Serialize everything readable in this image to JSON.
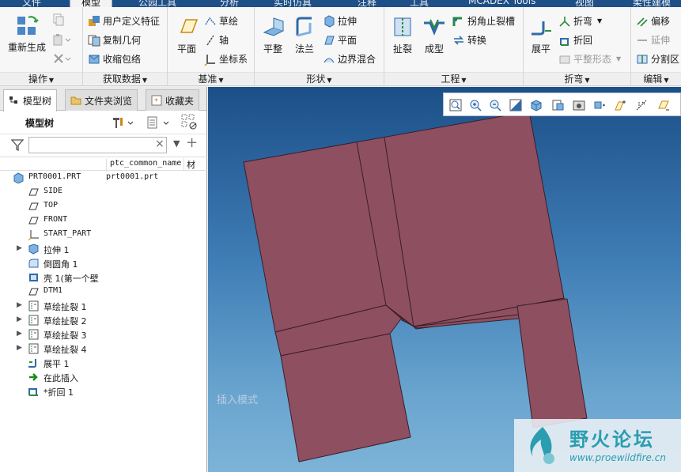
{
  "tabs": [
    "文件",
    "模型",
    "公园工具",
    "分析",
    "实时仿真",
    "注释",
    "工具",
    "MCADEX Tools",
    "视图",
    "柔性建模"
  ],
  "ribbon": {
    "operations": {
      "label": "操作",
      "regenerate": "重新生成"
    },
    "get_data": {
      "label": "获取数据",
      "udf": "用户定义特征",
      "copy_geom": "复制几何",
      "shrinkwrap": "收缩包络"
    },
    "datum": {
      "label": "基准",
      "plane": "平面",
      "sketch": "草绘",
      "axis": "轴",
      "csys": "坐标系"
    },
    "shapes": {
      "label": "形状",
      "flat": "平整",
      "flange": "法兰",
      "extrude": "拉伸",
      "plane": "平面",
      "blend": "边界混合"
    },
    "engineering": {
      "label": "工程",
      "rip": "扯裂",
      "form": "成型",
      "corner_relief": "拐角止裂槽",
      "convert": "转换"
    },
    "bend": {
      "label": "折弯",
      "unbend": "展平",
      "bend": "折弯",
      "bend_back": "折回",
      "flat_pattern": "平整形态"
    },
    "edit": {
      "label": "编辑",
      "offset": "偏移",
      "extend": "延伸",
      "split": "分割区"
    }
  },
  "panel": {
    "tabs": [
      "模型树",
      "文件夹浏览",
      "收藏夹"
    ],
    "tree_title": "模型树",
    "filter_placeholder": "",
    "columns": [
      "ptc_common_name",
      "材"
    ]
  },
  "tree": [
    {
      "label": "PRT0001.PRT",
      "icon": "part-icon",
      "col2": "prt0001.prt",
      "expandable": false
    },
    {
      "label": "SIDE",
      "icon": "datum-plane-icon",
      "expandable": false
    },
    {
      "label": "TOP",
      "icon": "datum-plane-icon",
      "expandable": false
    },
    {
      "label": "FRONT",
      "icon": "datum-plane-icon",
      "expandable": false
    },
    {
      "label": "START_PART",
      "icon": "csys-icon",
      "expandable": false
    },
    {
      "label": "拉伸 1",
      "icon": "extrude-icon",
      "expandable": true
    },
    {
      "label": "倒圆角 1",
      "icon": "round-icon",
      "expandable": false
    },
    {
      "label": "壳 1(第一个壁",
      "icon": "shell-icon",
      "expandable": false
    },
    {
      "label": "DTM1",
      "icon": "datum-plane-icon",
      "expandable": false
    },
    {
      "label": "草绘扯裂 1",
      "icon": "sketch-rip-icon",
      "expandable": true
    },
    {
      "label": "草绘扯裂 2",
      "icon": "sketch-rip-icon",
      "expandable": true
    },
    {
      "label": "草绘扯裂 3",
      "icon": "sketch-rip-icon",
      "expandable": true
    },
    {
      "label": "草绘扯裂 4",
      "icon": "sketch-rip-icon",
      "expandable": true
    },
    {
      "label": "展平 1",
      "icon": "unbend-icon",
      "expandable": false
    },
    {
      "label": "在此插入",
      "icon": "insert-here-icon",
      "expandable": false
    },
    {
      "label": "*折回 1",
      "icon": "bend-back-icon",
      "expandable": false
    }
  ],
  "viewport": {
    "mode_text": "插入模式",
    "part_color": "#8e4f61",
    "background_top": "#1c4f88",
    "background_bottom": "#7db3d7"
  },
  "watermark": {
    "title": "野火论坛",
    "url": "www.proewildfire.cn"
  }
}
